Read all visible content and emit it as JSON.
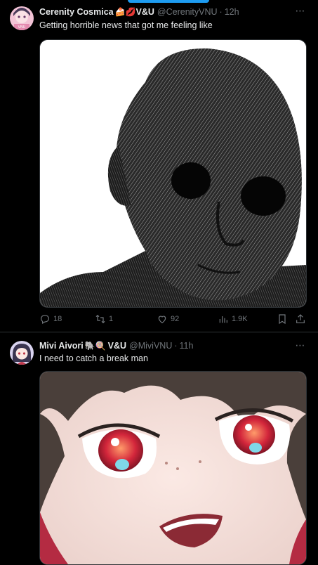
{
  "tweets": [
    {
      "author": "Cerenity Cosmica",
      "emojis": "🍰💋",
      "suffix": "V&U",
      "handle": "@CerenityVNU",
      "dot": "·",
      "time": "12h",
      "text": "Getting horrible news that got me feeling like",
      "media_icon": "sketched-face-image",
      "actions": {
        "reply": "18",
        "retweet": "1",
        "like": "92",
        "views": "1.9K"
      }
    },
    {
      "author": "Mivi Aivori",
      "emojis": "🐘🍭",
      "suffix": "V&U",
      "handle": "@MiviVNU",
      "dot": "·",
      "time": "11h",
      "text": "I need to catch a break man",
      "media_icon": "anime-crying-face-image"
    }
  ],
  "more_icon": "⋯",
  "colors": {
    "background": "#000000",
    "text": "#e7e9ea",
    "muted": "#71767b",
    "accent": "#1d9bf0",
    "divider": "#2f3336"
  }
}
